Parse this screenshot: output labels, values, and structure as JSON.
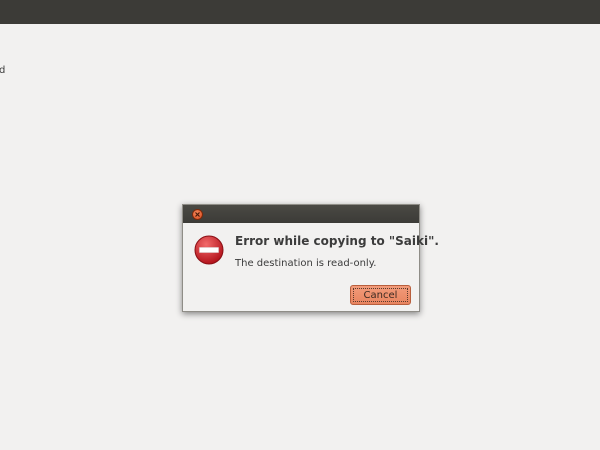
{
  "background": {
    "partial_text": "d"
  },
  "dialog": {
    "title": "Error while copying to \"Saiki\".",
    "message": "The destination is read-only.",
    "cancel_label": "Cancel",
    "icons": {
      "close": "close-icon",
      "error": "error-icon"
    }
  },
  "colors": {
    "top_bar": "#3c3b37",
    "desktop_bg": "#f2f1f0",
    "close_button": "#df4a16",
    "error_icon": "#c91d1d",
    "cancel_button": "#e8845f"
  }
}
